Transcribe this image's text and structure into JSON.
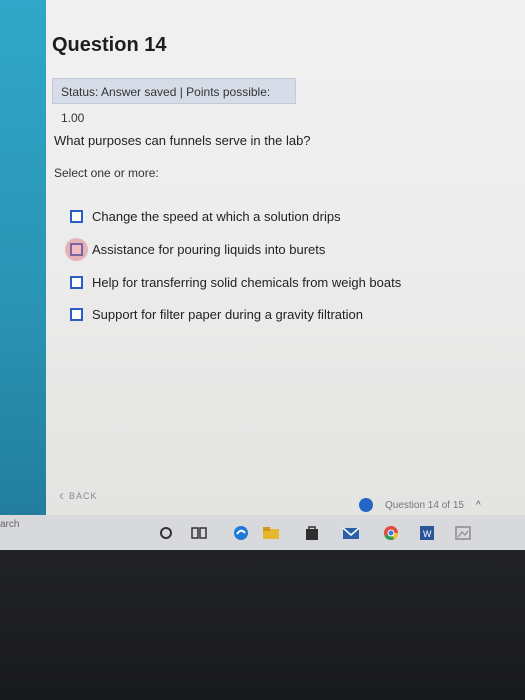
{
  "question": {
    "title": "Question 14",
    "status": "Status: Answer saved | Points possible: 1.00",
    "prompt": "What purposes can funnels serve in the lab?",
    "instruction": "Select one or more:",
    "options": [
      {
        "label": "Change the speed at which a solution drips",
        "checked": false
      },
      {
        "label": "Assistance for pouring liquids into burets",
        "checked": false
      },
      {
        "label": "Help for transferring solid chemicals from weigh boats",
        "checked": false
      },
      {
        "label": "Support for filter paper during a gravity filtration",
        "checked": false
      }
    ]
  },
  "navigation": {
    "back_label": "BACK",
    "progress_text": "Question 14 of 15"
  },
  "taskbar": {
    "search_text": "arch",
    "icons": [
      "cortana-icon",
      "task-view-icon",
      "edge-icon",
      "file-explorer-icon",
      "store-icon",
      "mail-icon",
      "chrome-icon",
      "word-icon",
      "photos-icon"
    ]
  },
  "colors": {
    "accent": "#2566c4",
    "checkbox_border": "#2c5dc2",
    "status_bg": "#d6dde8",
    "sidebar": "#2a93b4"
  }
}
